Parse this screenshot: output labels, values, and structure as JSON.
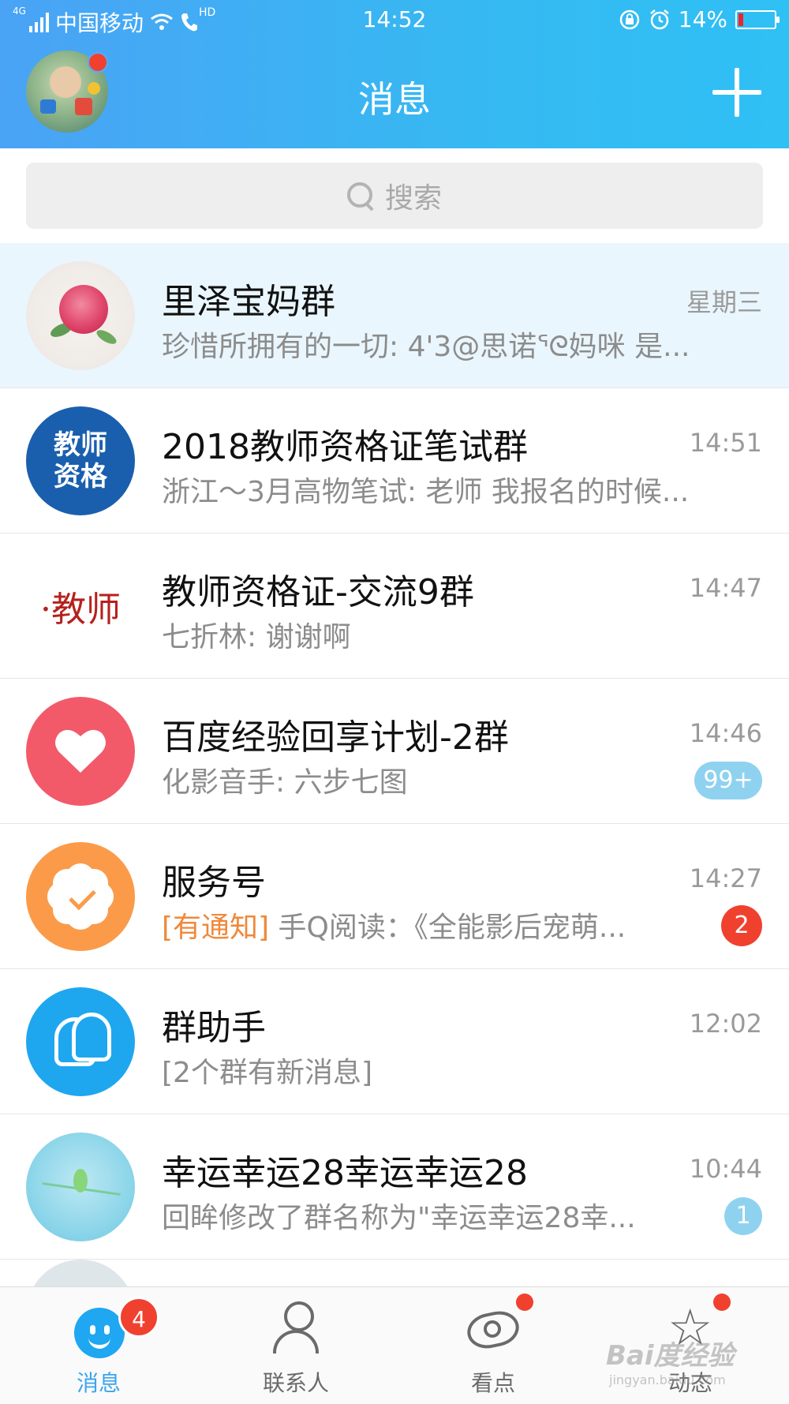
{
  "status_bar": {
    "network": "4G",
    "carrier": "中国移动",
    "hd": "HD",
    "time": "14:52",
    "battery": "14%",
    "battery_color": "#e8252e"
  },
  "header": {
    "title": "消息",
    "add_icon": "plus-icon",
    "accent": "#3aa5ee"
  },
  "search": {
    "placeholder": "搜索"
  },
  "conversations": [
    {
      "name": "里泽宝妈群",
      "preview": "珍惜所拥有的一切: 4'3@思诺ᕐᘓ妈咪 是...",
      "time": "星期三",
      "pinned": true
    },
    {
      "name": "2018教师资格证笔试群",
      "preview": "浙江～3月高物笔试: 老师 我报名的时候...",
      "time": "14:51",
      "avatar_text": "教师\n资格"
    },
    {
      "name": "教师资格证-交流9群",
      "preview": "七折林: 谢谢啊",
      "time": "14:47",
      "avatar_text": "·教师"
    },
    {
      "name": "百度经验回享计划-2群",
      "preview": "化影音手: 六步七图",
      "time": "14:46",
      "badge": "99+"
    },
    {
      "name": "服务号",
      "preview_tag": "[有通知]",
      "preview": " 手Q阅读：《全能影后宠萌...",
      "time": "14:27",
      "badge": "2"
    },
    {
      "name": "群助手",
      "preview_tag": "[2个群有新消息]",
      "time": "12:02"
    },
    {
      "name": "幸运幸运28幸运幸运28",
      "preview": "回眸修改了群名称为\"幸运幸运28幸...",
      "time": "10:44",
      "badge": "1"
    }
  ],
  "bottom_nav": {
    "tabs": [
      {
        "label": "消息",
        "badge": "4",
        "icon": "qq-face-icon",
        "active": true
      },
      {
        "label": "联系人",
        "icon": "contact-icon"
      },
      {
        "label": "看点",
        "icon": "eye-icon",
        "dot": true
      },
      {
        "label": "动态",
        "icon": "star-icon",
        "dot": true
      }
    ]
  },
  "watermark": {
    "text": "Bai度经验",
    "url": "jingyan.baidu.com"
  }
}
